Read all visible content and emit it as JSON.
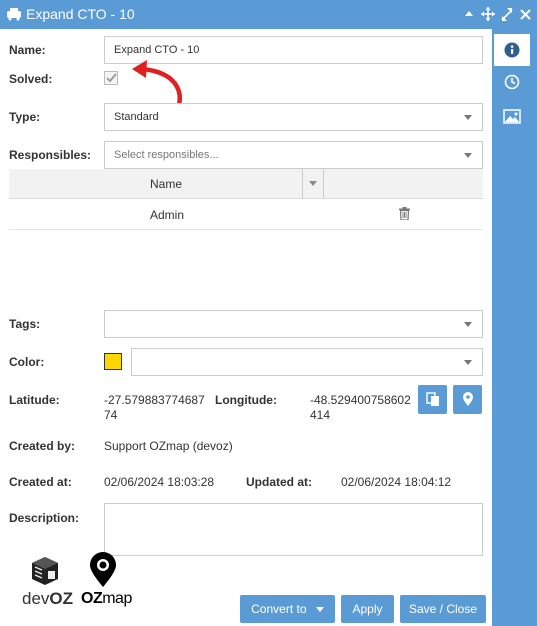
{
  "window": {
    "title": "Expand CTO - 10"
  },
  "form": {
    "name_label": "Name:",
    "name_value": "Expand CTO - 10",
    "solved_label": "Solved:",
    "type_label": "Type:",
    "type_value": "Standard",
    "responsibles_label": "Responsibles:",
    "responsibles_placeholder": "Select responsibles...",
    "table": {
      "column_header": "Name",
      "rows": [
        {
          "name": "Admin"
        }
      ]
    },
    "tags_label": "Tags:",
    "color_label": "Color:",
    "color_value": "#ffd600",
    "latitude_label": "Latitude:",
    "latitude_value_1": "-27.579883774687",
    "latitude_value_2": "74",
    "longitude_label": "Longitude:",
    "longitude_value_1": "-48.529400758602",
    "longitude_value_2": "414",
    "created_by_label": "Created by:",
    "created_by_value": "Support OZmap (devoz)",
    "created_at_label": "Created at:",
    "created_at_value": "02/06/2024 18:03:28",
    "updated_at_label": "Updated at:",
    "updated_at_value": "02/06/2024 18:04:12",
    "description_label": "Description:"
  },
  "logos": {
    "devoz_text_1": "dev",
    "devoz_text_2": "OZ",
    "ozmap_text_1": "OZ",
    "ozmap_text_2": "map"
  },
  "footer": {
    "convert_label": "Convert to",
    "apply_label": "Apply",
    "save_label": "Save / Close"
  },
  "colors": {
    "accent": "#5b9bd5",
    "annotation_arrow": "#e02020"
  }
}
